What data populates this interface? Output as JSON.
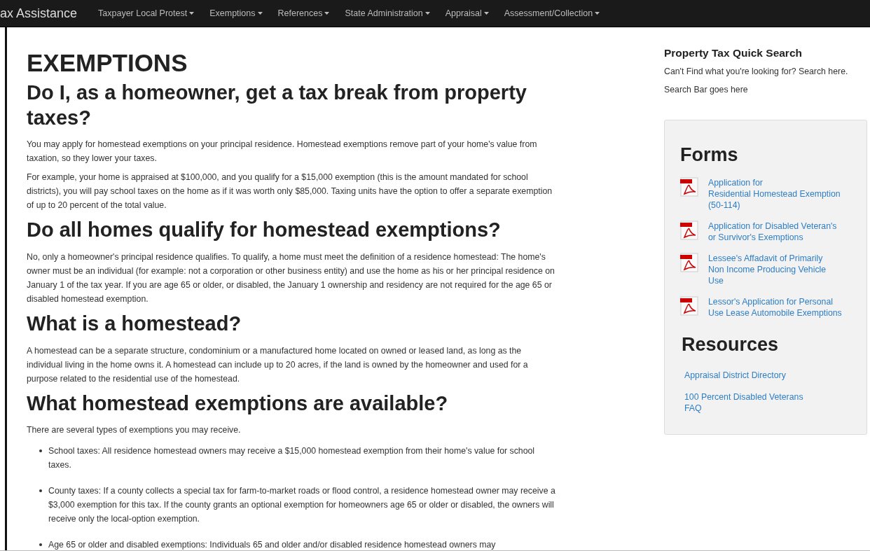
{
  "navbar": {
    "brand": "ax Assistance",
    "menus": [
      {
        "label": "Taxpayer Local Protest"
      },
      {
        "label": "Exemptions"
      },
      {
        "label": "References"
      },
      {
        "label": "State Administration"
      },
      {
        "label": "Appraisal"
      },
      {
        "label": "Assessment/Collection"
      }
    ]
  },
  "main": {
    "title": "EXEMPTIONS",
    "sections": [
      {
        "heading": "Do I, as a homeowner, get a tax break from property taxes?",
        "paragraphs": [
          "You may apply for homestead exemptions on your principal residence. Homestead exemptions remove part of your home's value from taxation, so they lower your taxes.",
          "For example, your home is appraised at $100,000, and you qualify for a $15,000 exemption (this is the amount mandated for school districts), you will pay school taxes on the home as if it was worth only $85,000. Taxing units have the option to offer a separate exemption of up to 20 percent of the total value."
        ]
      },
      {
        "heading": "Do all homes qualify for homestead exemptions?",
        "paragraphs": [
          "No, only a homeowner's principal residence qualifies. To qualify, a home must meet the definition of a residence homestead: The home's owner must be an individual (for example: not a corporation or other business entity) and use the home as his or her principal residence on January 1 of the tax year. If you are age 65 or older, or disabled, the January 1 ownership and residency are not required for the age 65 or disabled homestead exemption."
        ]
      },
      {
        "heading": "What is a homestead?",
        "paragraphs": [
          "A homestead can be a separate structure, condominium or a manufactured home located on owned or leased land, as long as the individual living in the home owns it. A homestead can include up to 20 acres, if the land is owned by the homeowner and used for a purpose related to the residential use of the homestead."
        ]
      },
      {
        "heading": "What homestead exemptions are available?",
        "paragraphs": [
          "There are several types of exemptions you may receive."
        ],
        "bullets": [
          "School taxes: All residence homestead owners may receive a $15,000 homestead exemption from their home's value for school taxes.",
          "County taxes: If a county collects a special tax for farm-to-market roads or flood control, a residence homestead owner may receive a $3,000 exemption for this tax. If the county grants an optional exemption for homeowners age 65 or older or disabled, the owners will receive only the local-option exemption.",
          "Age 65 or older and disabled exemptions: Individuals 65 and older and/or disabled residence homestead owners may"
        ]
      }
    ]
  },
  "sidebar": {
    "search_title": "Property Tax Quick Search",
    "search_hint": "Can't Find what you're looking for? Search here.",
    "search_note": "Search Bar goes here",
    "forms_heading": "Forms",
    "forms": [
      {
        "lines": [
          "Application for",
          "Residential Homestead Exemption",
          "(50-114)"
        ]
      },
      {
        "lines": [
          "Application for Disabled Veteran's",
          "or Survivor's Exemptions"
        ]
      },
      {
        "lines": [
          "Lessee's Affadavit of Primarily",
          "Non Income Producing Vehicle",
          "Use"
        ]
      },
      {
        "lines": [
          "Lessor's Application for Personal",
          "Use Lease Automobile Exemptions"
        ]
      }
    ],
    "resources_heading": "Resources",
    "resources": [
      {
        "lines": [
          "Appraisal District Directory"
        ]
      },
      {
        "lines": [
          "100 Percent Disabled Veterans",
          "FAQ"
        ]
      }
    ]
  }
}
